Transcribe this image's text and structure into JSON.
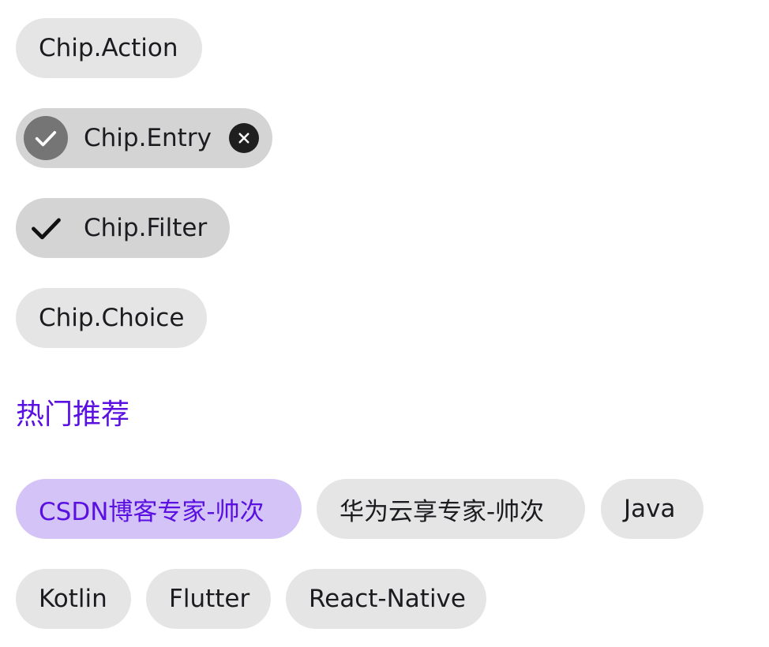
{
  "chips": {
    "action": {
      "label": "Chip.Action"
    },
    "entry": {
      "label": "Chip.Entry",
      "avatar_icon": "check-icon",
      "close_icon": "close-icon"
    },
    "filter": {
      "label": "Chip.Filter",
      "check_icon": "check-icon"
    },
    "choice": {
      "label": "Chip.Choice"
    }
  },
  "hot_section": {
    "title": "热门推荐",
    "tags": [
      {
        "label": "CSDN博客专家-帅次",
        "selected": true
      },
      {
        "label": "华为云享专家-帅次",
        "selected": false
      },
      {
        "label": "Java",
        "selected": false
      },
      {
        "label": "Kotlin",
        "selected": false
      },
      {
        "label": "Flutter",
        "selected": false
      },
      {
        "label": "React-Native",
        "selected": false
      }
    ]
  },
  "colors": {
    "chip_background": "#e5e5e5",
    "chip_checked_background": "#d4d4d4",
    "selected_background": "#d4c3f7",
    "accent": "#5a10e0",
    "text": "#1c1b1f"
  }
}
